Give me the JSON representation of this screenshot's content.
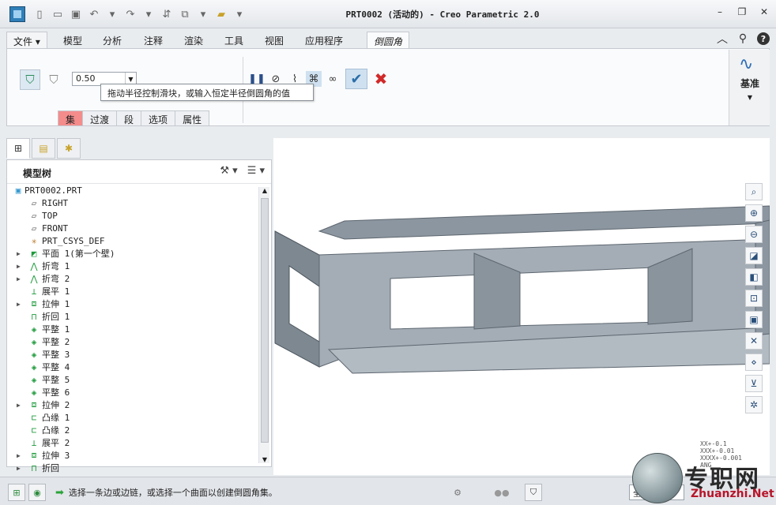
{
  "window": {
    "title": "PRT0002 (活动的) - Creo Parametric 2.0"
  },
  "menu": {
    "tabs": [
      {
        "label": "文件 ▾"
      },
      {
        "label": "模型"
      },
      {
        "label": "分析"
      },
      {
        "label": "注释"
      },
      {
        "label": "渲染"
      },
      {
        "label": "工具"
      },
      {
        "label": "视图"
      },
      {
        "label": "应用程序"
      },
      {
        "label": "倒圆角"
      }
    ]
  },
  "ribbon": {
    "radius_value": "0.50",
    "subtabs": [
      "集",
      "过渡",
      "段",
      "选项",
      "属性"
    ],
    "datum_label": "基准",
    "tooltip": "拖动半径控制滑块，或输入恒定半径倒圆角的值"
  },
  "model_tree": {
    "title": "模型树",
    "items": [
      {
        "label": "PRT0002.PRT",
        "icon": "part-icon",
        "expand": ""
      },
      {
        "label": "RIGHT",
        "icon": "datum-plane-icon",
        "expand": ""
      },
      {
        "label": "TOP",
        "icon": "datum-plane-icon",
        "expand": ""
      },
      {
        "label": "FRONT",
        "icon": "datum-plane-icon",
        "expand": ""
      },
      {
        "label": "PRT_CSYS_DEF",
        "icon": "csys-icon",
        "expand": ""
      },
      {
        "label": "平面 1(第一个壁)",
        "icon": "flat-wall-icon",
        "expand": "▶"
      },
      {
        "label": "折弯 1",
        "icon": "bend-icon",
        "expand": "▶"
      },
      {
        "label": "折弯 2",
        "icon": "bend-icon",
        "expand": "▶"
      },
      {
        "label": "展平 1",
        "icon": "unbend-icon",
        "expand": ""
      },
      {
        "label": "拉伸 1",
        "icon": "extrude-icon",
        "expand": "▶"
      },
      {
        "label": "折回 1",
        "icon": "bend-back-icon",
        "expand": ""
      },
      {
        "label": "平整 1",
        "icon": "flat-icon",
        "expand": ""
      },
      {
        "label": "平整 2",
        "icon": "flat-icon",
        "expand": ""
      },
      {
        "label": "平整 3",
        "icon": "flat-icon",
        "expand": ""
      },
      {
        "label": "平整 4",
        "icon": "flat-icon",
        "expand": ""
      },
      {
        "label": "平整 5",
        "icon": "flat-icon",
        "expand": ""
      },
      {
        "label": "平整 6",
        "icon": "flat-icon",
        "expand": ""
      },
      {
        "label": "拉伸 2",
        "icon": "extrude-icon",
        "expand": "▶"
      },
      {
        "label": "凸缘 1",
        "icon": "flange-icon",
        "expand": ""
      },
      {
        "label": "凸缘 2",
        "icon": "flange-icon",
        "expand": ""
      },
      {
        "label": "展平 2",
        "icon": "unbend-icon",
        "expand": ""
      },
      {
        "label": "拉伸 3",
        "icon": "extrude-icon",
        "expand": "▶"
      },
      {
        "label": "折回",
        "icon": "bend-back-icon",
        "expand": "▶"
      }
    ]
  },
  "tolerance": [
    "XX+-0.1",
    "XXX+-0.01",
    "XXXX+-0.001",
    "ANG"
  ],
  "status": {
    "message": "选择一条边或边链，或选择一个曲面以创建倒圆角集。",
    "filter": "全部"
  },
  "watermark": {
    "cn": "专职网",
    "en": "Zhuanzhi.Net"
  },
  "colors": {
    "part_gray": "#9aa4ad",
    "accent_red": "#d12a2a",
    "active_subtab": "#f48c8c"
  }
}
